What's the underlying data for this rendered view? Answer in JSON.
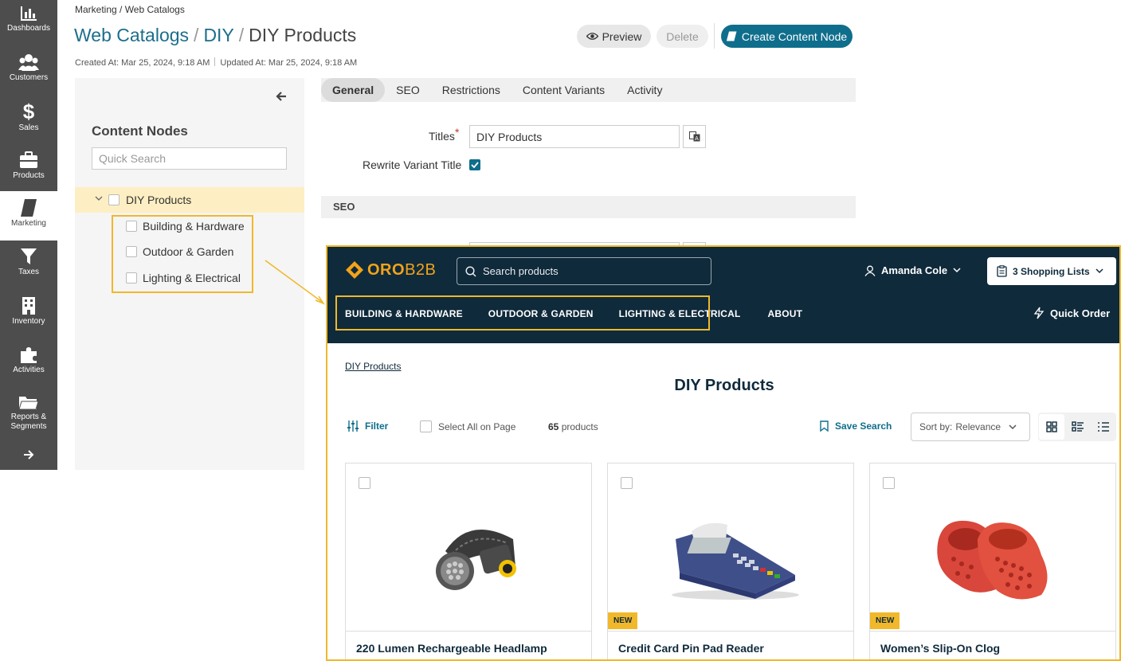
{
  "sidebar": {
    "items": [
      {
        "label": "Dashboards",
        "icon": "bar-chart-icon"
      },
      {
        "label": "Customers",
        "icon": "users-icon"
      },
      {
        "label": "Sales",
        "icon": "dollar-icon"
      },
      {
        "label": "Products",
        "icon": "briefcase-icon"
      },
      {
        "label": "Marketing",
        "icon": "book-icon"
      },
      {
        "label": "Taxes",
        "icon": "filter-icon"
      },
      {
        "label": "Inventory",
        "icon": "building-icon"
      },
      {
        "label": "Activities",
        "icon": "puzzle-icon"
      },
      {
        "label": "Reports & Segments",
        "icon": "folder-icon"
      }
    ],
    "active": "Marketing"
  },
  "header": {
    "breadcrumb": "Marketing / Web Catalogs",
    "title_parts": [
      "Web Catalogs",
      "DIY",
      "DIY Products"
    ],
    "created": "Created At: Mar 25, 2024, 9:18 AM",
    "updated": "Updated At: Mar 25, 2024, 9:18 AM",
    "preview_label": "Preview",
    "delete_label": "Delete",
    "create_label": "Create Content Node"
  },
  "tree": {
    "title": "Content Nodes",
    "search_placeholder": "Quick Search",
    "root": "DIY Products",
    "children": [
      "Building & Hardware",
      "Outdoor & Garden",
      "Lighting & Electrical"
    ]
  },
  "tabs": [
    "General",
    "SEO",
    "Restrictions",
    "Content Variants",
    "Activity"
  ],
  "form": {
    "titles_label": "Titles",
    "required_mark": "*",
    "titles_value": "DIY Products",
    "rewrite_label": "Rewrite Variant Title",
    "rewrite_checked": true,
    "seo_section": "SEO"
  },
  "storefront": {
    "logo": {
      "a": "ORO",
      "b": "B2B"
    },
    "search_placeholder": "Search products",
    "user": "Amanda Cole",
    "shopping_lists": "3 Shopping Lists",
    "menu": [
      "BUILDING & HARDWARE",
      "OUTDOOR & GARDEN",
      "LIGHTING & ELECTRICAL",
      "ABOUT"
    ],
    "quick_order": "Quick Order",
    "breadcrumb": "DIY Products",
    "title": "DIY Products",
    "filter": "Filter",
    "select_all": "Select All on Page",
    "count_num": "65",
    "count_text": "products",
    "save_search": "Save Search",
    "sort_label": "Sort by:",
    "sort_value": "Relevance",
    "products": [
      {
        "name": "220 Lumen Rechargeable Headlamp",
        "badge": ""
      },
      {
        "name": "Credit Card Pin Pad Reader",
        "badge": "NEW"
      },
      {
        "name": "Women’s Slip-On Clog",
        "badge": "NEW"
      }
    ]
  },
  "colors": {
    "accent": "#0f6e8c",
    "highlight": "#f0b82a",
    "store_dark": "#0f2a3b",
    "sidebar": "#4d4d4d"
  }
}
